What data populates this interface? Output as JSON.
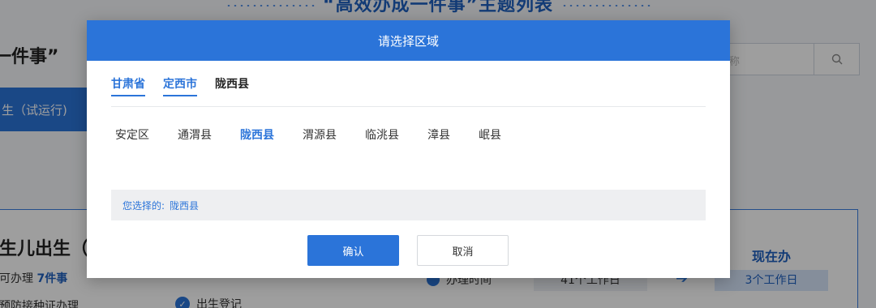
{
  "background": {
    "page_title": "“高效办成一件事”主题列表",
    "section_heading": "一件事”",
    "search_placeholder": "称",
    "active_tab": "生（试运行)",
    "card": {
      "title": "生儿出生（试",
      "sub_prefix": "可办理",
      "sub_count": "7件事",
      "item1": "预防接种证办理",
      "item2": "出生登记",
      "time_label": "办理时间",
      "old_days": "41个工作日",
      "now_label": "现在办",
      "now_days": "3个工作日"
    }
  },
  "modal": {
    "title": "请选择区域",
    "breadcrumbs": [
      "甘肃省",
      "定西市",
      "陇西县"
    ],
    "options": [
      "安定区",
      "通渭县",
      "陇西县",
      "渭源县",
      "临洮县",
      "漳县",
      "岷县"
    ],
    "selected_option": "陇西县",
    "selection_label": "您选择的:",
    "selection_value": "陇西县",
    "confirm_label": "确认",
    "cancel_label": "取消"
  },
  "colors": {
    "accent": "#2b74d9",
    "overlay": "rgba(0,0,0,0.38)"
  }
}
